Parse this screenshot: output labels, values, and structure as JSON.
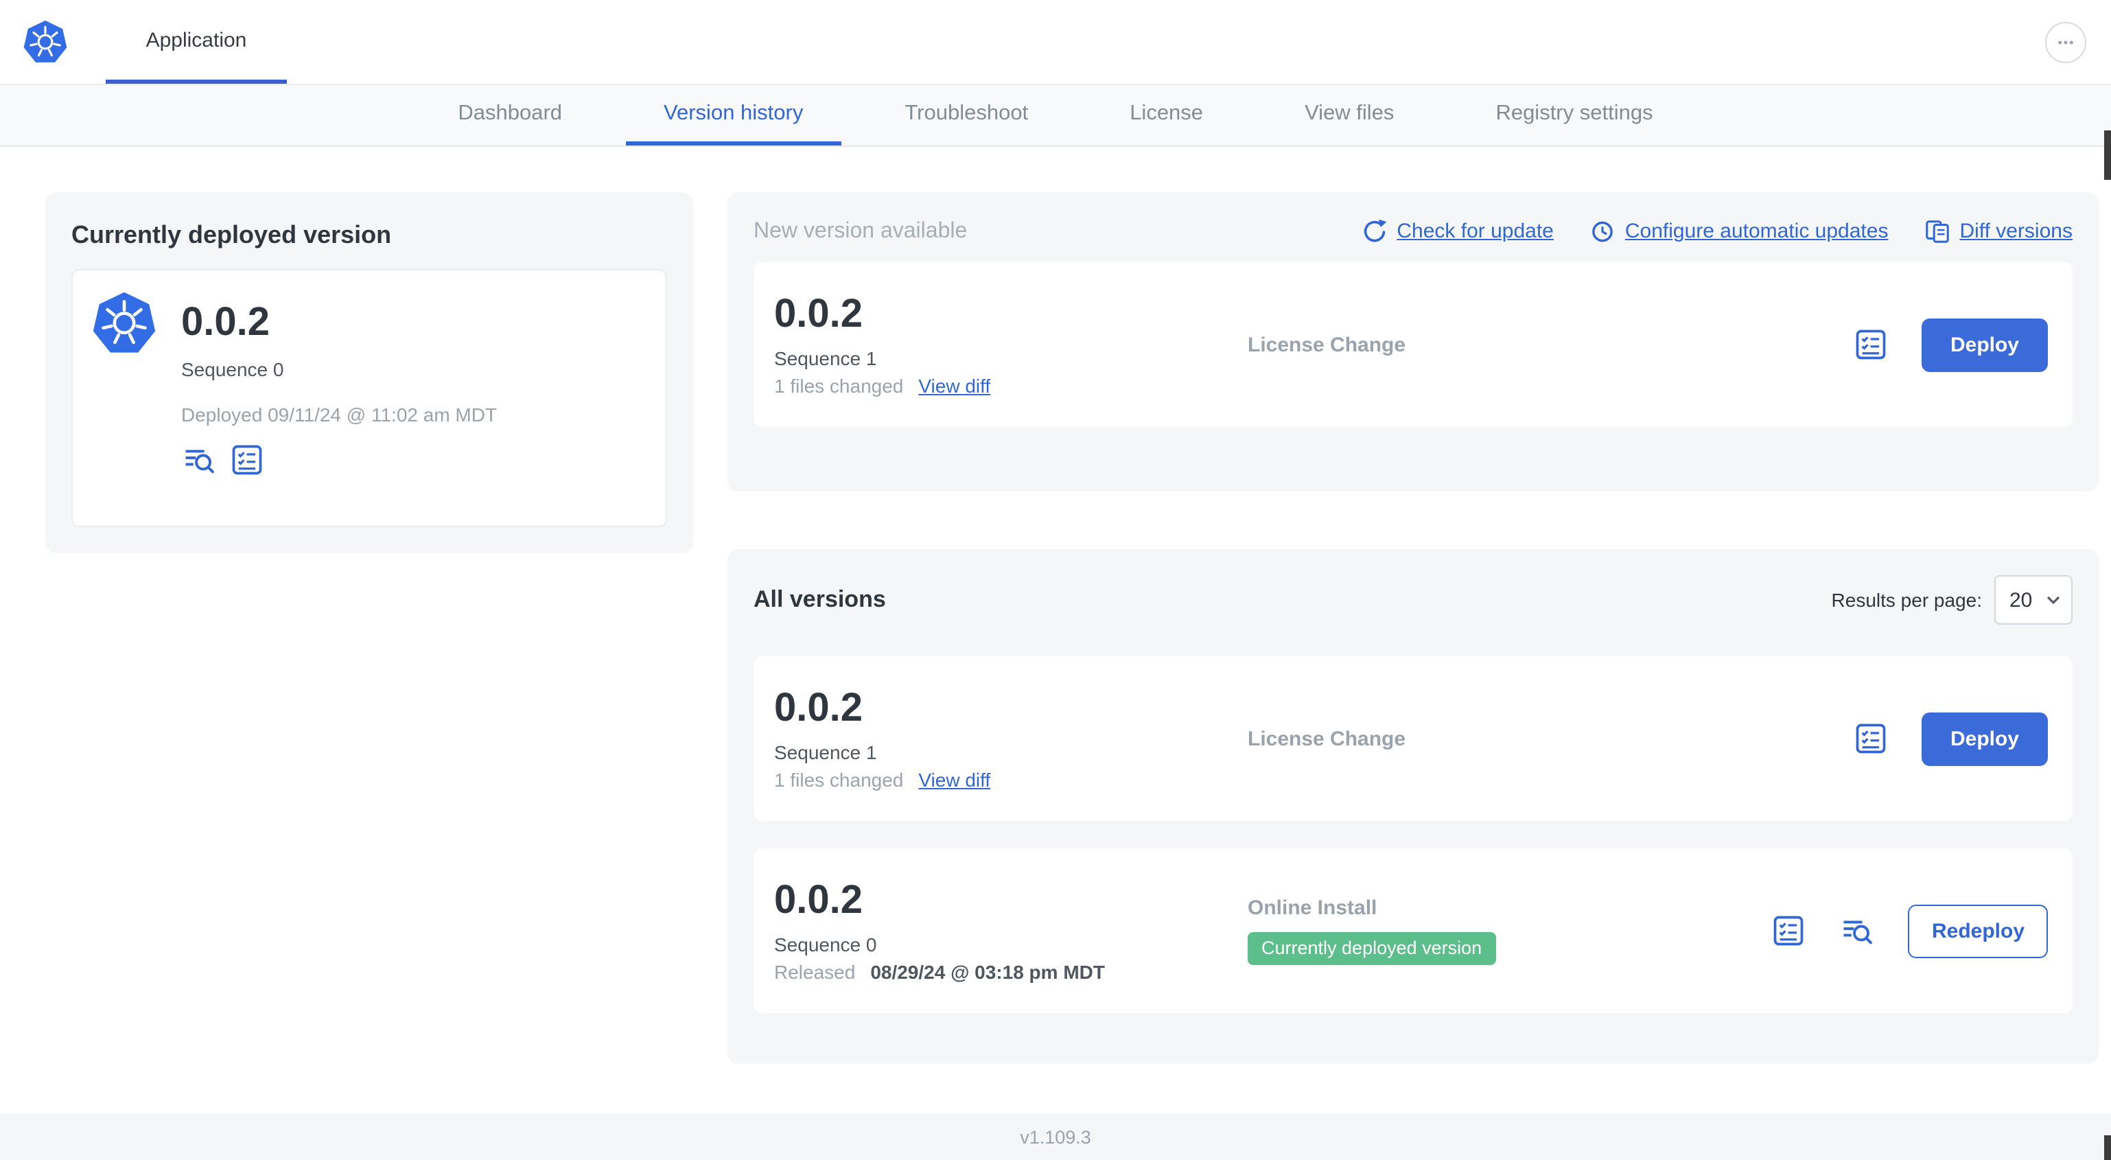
{
  "header": {
    "app_title": "Application"
  },
  "nav": {
    "tabs": [
      {
        "label": "Dashboard",
        "active": false
      },
      {
        "label": "Version history",
        "active": true
      },
      {
        "label": "Troubleshoot",
        "active": false
      },
      {
        "label": "License",
        "active": false
      },
      {
        "label": "View files",
        "active": false
      },
      {
        "label": "Registry settings",
        "active": false
      }
    ]
  },
  "current_version": {
    "panel_title": "Currently deployed version",
    "version": "0.0.2",
    "sequence": "Sequence 0",
    "deployed": "Deployed 09/11/24 @ 11:02 am MDT"
  },
  "new_version": {
    "panel_title": "New version available",
    "actions": {
      "check": "Check for update",
      "configure": "Configure automatic updates",
      "diff": "Diff versions"
    },
    "card": {
      "version": "0.0.2",
      "sequence": "Sequence 1",
      "files_changed": "1 files changed",
      "view_diff": "View diff",
      "source": "License Change",
      "deploy_label": "Deploy"
    }
  },
  "all_versions": {
    "panel_title": "All versions",
    "results_per_page_label": "Results per page:",
    "results_per_page_value": "20",
    "rows": [
      {
        "version": "0.0.2",
        "sequence": "Sequence 1",
        "files_changed": "1 files changed",
        "view_diff": "View diff",
        "source": "License Change",
        "action_label": "Deploy"
      },
      {
        "version": "0.0.2",
        "sequence": "Sequence 0",
        "released_label": "Released",
        "released_date": "08/29/24 @ 03:18 pm MDT",
        "source": "Online Install",
        "badge": "Currently deployed version",
        "action_label": "Redeploy"
      }
    ]
  },
  "footer": {
    "version": "v1.109.3"
  },
  "icons": {
    "kubernetes-logo": "blue heptagon with white ship-wheel helm",
    "more-menu": "ellipsis in circle",
    "check-for-update": "circular refresh arrow",
    "configure-automatic-updates": "clock",
    "diff-versions": "two overlapping documents",
    "release-notes": "bordered checklist",
    "view-logs": "text lines with magnifier",
    "select-chevron": "chevron-down"
  },
  "colors": {
    "accent_blue": "#3066d6",
    "button_blue": "#3b6bd9",
    "kubernetes_blue": "#326de6",
    "badge_green": "#5cbe8a",
    "panel_gray": "#f4f6f8",
    "muted_text": "#9aa3ab",
    "dark_text": "#30363d"
  }
}
